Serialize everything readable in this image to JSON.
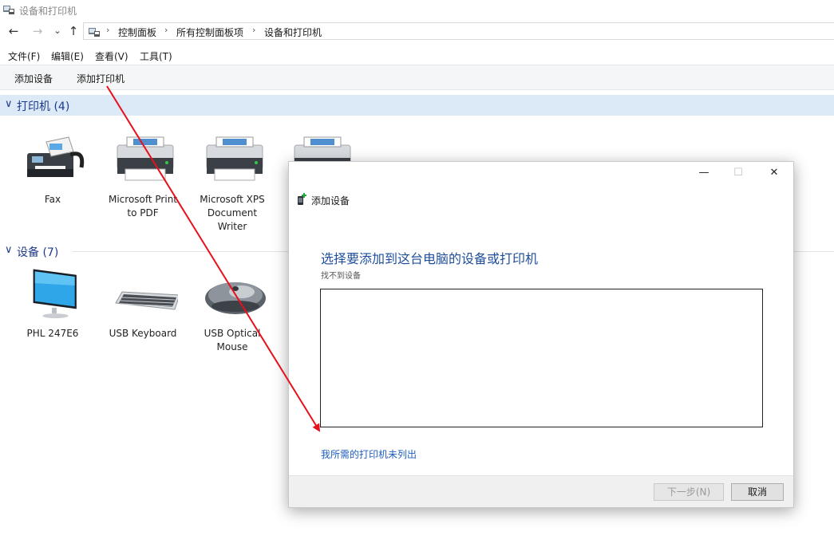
{
  "window": {
    "title": "设备和打印机"
  },
  "nav": {
    "back_icon": "←",
    "forward_icon": "→",
    "recent_icon": "⌄",
    "up_icon": "↑",
    "breadcrumbs": [
      "控制面板",
      "所有控制面板项",
      "设备和打印机"
    ],
    "separator": "›"
  },
  "menu": [
    "文件(F)",
    "编辑(E)",
    "查看(V)",
    "工具(T)"
  ],
  "commands": [
    "添加设备",
    "添加打印机"
  ],
  "groups": {
    "printers": {
      "title": "打印机 (4)",
      "chevron": "∨",
      "items": [
        {
          "label": "Fax",
          "icon": "fax-icon"
        },
        {
          "label": "Microsoft Print to PDF",
          "icon": "printer-icon"
        },
        {
          "label": "Microsoft XPS Document Writer",
          "icon": "printer-icon"
        },
        {
          "label": "",
          "icon": "printer-icon"
        }
      ]
    },
    "devices": {
      "title": "设备 (7)",
      "chevron": "∨",
      "items": [
        {
          "label": "PHL 247E6",
          "icon": "monitor-icon"
        },
        {
          "label": "USB Keyboard",
          "icon": "keyboard-icon"
        },
        {
          "label": "USB Optical Mouse",
          "icon": "mouse-icon"
        }
      ]
    }
  },
  "dialog": {
    "minimize_icon": "—",
    "maximize_icon": "☐",
    "close_icon": "✕",
    "title": "添加设备",
    "heading": "选择要添加到这台电脑的设备或打印机",
    "status": "找不到设备",
    "link": "我所需的打印机未列出",
    "next_button": "下一步(N)",
    "cancel_button": "取消"
  },
  "colors": {
    "accent": "#1f4e9c",
    "link": "#1f5fbf",
    "annotation_arrow": "#e8101a",
    "group_header_bg": "#dce9f7"
  }
}
